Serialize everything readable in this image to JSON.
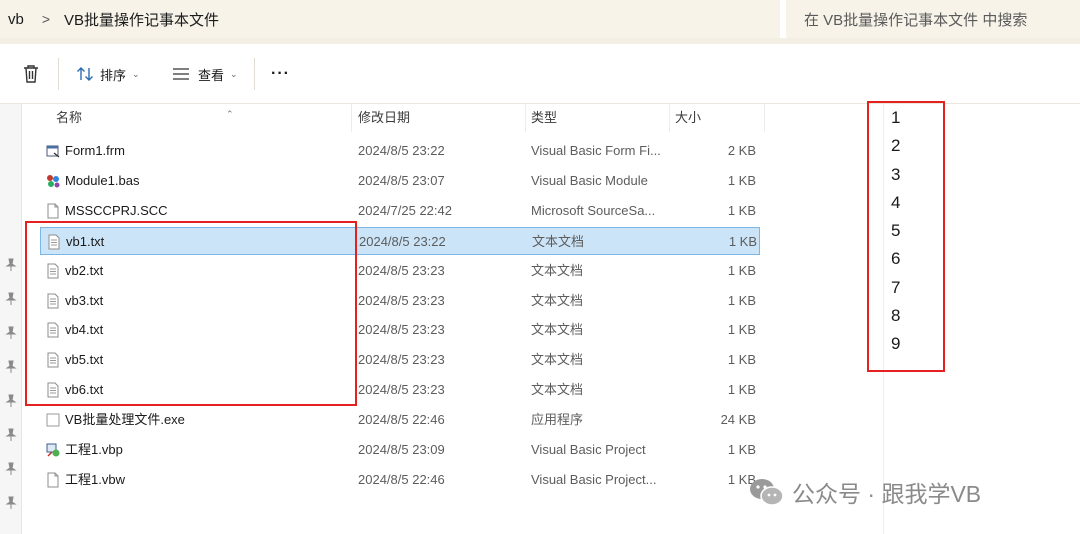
{
  "address": {
    "root": "vb",
    "separator": ">",
    "folder": "VB批量操作记事本文件"
  },
  "search": {
    "placeholder": "在 VB批量操作记事本文件 中搜索"
  },
  "toolbar": {
    "sort_label": "排序",
    "view_label": "查看",
    "more_label": "···"
  },
  "columns": {
    "name": "名称",
    "date": "修改日期",
    "type": "类型",
    "size": "大小"
  },
  "files": [
    {
      "name": "Form1.frm",
      "date": "2024/8/5 23:22",
      "type": "Visual Basic Form Fi...",
      "size": "2 KB",
      "icon": "vb-form-icon"
    },
    {
      "name": "Module1.bas",
      "date": "2024/8/5 23:07",
      "type": "Visual Basic Module",
      "size": "1 KB",
      "icon": "vb-module-icon"
    },
    {
      "name": "MSSCCPRJ.SCC",
      "date": "2024/7/25 22:42",
      "type": "Microsoft SourceSa...",
      "size": "1 KB",
      "icon": "blank-file-icon"
    },
    {
      "name": "vb1.txt",
      "date": "2024/8/5 23:22",
      "type": "文本文档",
      "size": "1 KB",
      "icon": "text-file-icon",
      "selected": true
    },
    {
      "name": "vb2.txt",
      "date": "2024/8/5 23:23",
      "type": "文本文档",
      "size": "1 KB",
      "icon": "text-file-icon"
    },
    {
      "name": "vb3.txt",
      "date": "2024/8/5 23:23",
      "type": "文本文档",
      "size": "1 KB",
      "icon": "text-file-icon"
    },
    {
      "name": "vb4.txt",
      "date": "2024/8/5 23:23",
      "type": "文本文档",
      "size": "1 KB",
      "icon": "text-file-icon"
    },
    {
      "name": "vb5.txt",
      "date": "2024/8/5 23:23",
      "type": "文本文档",
      "size": "1 KB",
      "icon": "text-file-icon"
    },
    {
      "name": "vb6.txt",
      "date": "2024/8/5 23:23",
      "type": "文本文档",
      "size": "1 KB",
      "icon": "text-file-icon"
    },
    {
      "name": "VB批量处理文件.exe",
      "date": "2024/8/5 22:46",
      "type": "应用程序",
      "size": "24 KB",
      "icon": "exe-file-icon"
    },
    {
      "name": "工程1.vbp",
      "date": "2024/8/5 23:09",
      "type": "Visual Basic Project",
      "size": "1 KB",
      "icon": "vb-project-icon"
    },
    {
      "name": "工程1.vbw",
      "date": "2024/8/5 22:46",
      "type": "Visual Basic Project...",
      "size": "1 KB",
      "icon": "blank-file-icon"
    }
  ],
  "notepad_lines": [
    "1",
    "2",
    "3",
    "4",
    "5",
    "6",
    "7",
    "8",
    "9"
  ],
  "watermark": {
    "text": "公众号 · 跟我学VB"
  },
  "colors": {
    "selection": "#cce4f7",
    "annotation_red": "#e5211f",
    "chrome": "#f7f3e9"
  }
}
